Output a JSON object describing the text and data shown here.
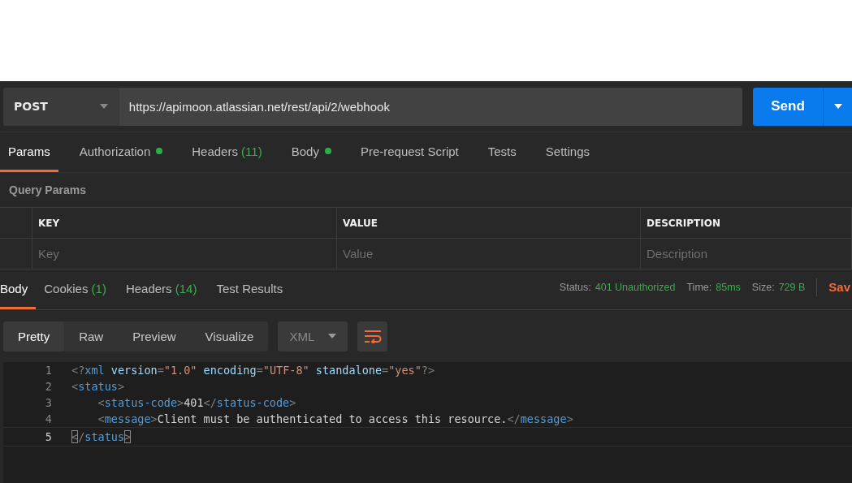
{
  "request": {
    "method": "POST",
    "url": "https://apimoon.atlassian.net/rest/api/2/webhook",
    "send_label": "Send"
  },
  "request_tabs": [
    {
      "label": "Params",
      "indicator": false,
      "selected": true
    },
    {
      "label": "Authorization",
      "indicator": true,
      "selected": false
    },
    {
      "label": "Headers",
      "count": "(11)",
      "indicator": false,
      "selected": false
    },
    {
      "label": "Body",
      "indicator": true,
      "selected": false
    },
    {
      "label": "Pre-request Script",
      "indicator": false,
      "selected": false
    },
    {
      "label": "Tests",
      "indicator": false,
      "selected": false
    },
    {
      "label": "Settings",
      "indicator": false,
      "selected": false
    }
  ],
  "query_params": {
    "title": "Query Params",
    "columns": [
      "KEY",
      "VALUE",
      "DESCRIPTION"
    ],
    "placeholders": [
      "Key",
      "Value",
      "Description"
    ]
  },
  "response_tabs": [
    {
      "label": "Body",
      "selected": true
    },
    {
      "label": "Cookies",
      "count": "(1)",
      "selected": false
    },
    {
      "label": "Headers",
      "count": "(14)",
      "selected": false
    },
    {
      "label": "Test Results",
      "selected": false
    }
  ],
  "response_meta": [
    {
      "label": "Status:",
      "value": "401 Unauthorized"
    },
    {
      "label": "Time:",
      "value": "85ms"
    },
    {
      "label": "Size:",
      "value": "729 B"
    }
  ],
  "save_label": "Sav",
  "view_modes": [
    {
      "label": "Pretty",
      "selected": true
    },
    {
      "label": "Raw",
      "selected": false
    },
    {
      "label": "Preview",
      "selected": false
    },
    {
      "label": "Visualize",
      "selected": false
    }
  ],
  "format": "XML",
  "code_lines": [
    {
      "number": "1",
      "active": false,
      "tokens": [
        {
          "kind": "punct",
          "text": "<?"
        },
        {
          "kind": "tag",
          "text": "xml"
        },
        {
          "kind": "attr",
          "text": " version"
        },
        {
          "kind": "punct",
          "text": "="
        },
        {
          "kind": "string",
          "text": "\"1.0\""
        },
        {
          "kind": "attr",
          "text": " encoding"
        },
        {
          "kind": "punct",
          "text": "="
        },
        {
          "kind": "string",
          "text": "\"UTF-8\""
        },
        {
          "kind": "attr",
          "text": " standalone"
        },
        {
          "kind": "punct",
          "text": "="
        },
        {
          "kind": "string",
          "text": "\"yes\""
        },
        {
          "kind": "punct",
          "text": "?>"
        }
      ]
    },
    {
      "number": "2",
      "active": false,
      "tokens": [
        {
          "kind": "punct",
          "text": "<"
        },
        {
          "kind": "tag",
          "text": "status"
        },
        {
          "kind": "punct",
          "text": ">"
        }
      ]
    },
    {
      "number": "3",
      "active": false,
      "tokens": [
        {
          "kind": "punct",
          "text": "    <"
        },
        {
          "kind": "tag",
          "text": "status-code"
        },
        {
          "kind": "punct",
          "text": ">"
        },
        {
          "kind": "text",
          "text": "401"
        },
        {
          "kind": "punct",
          "text": "</"
        },
        {
          "kind": "tag",
          "text": "status-code"
        },
        {
          "kind": "punct",
          "text": ">"
        }
      ]
    },
    {
      "number": "4",
      "active": false,
      "tokens": [
        {
          "kind": "punct",
          "text": "    <"
        },
        {
          "kind": "tag",
          "text": "message"
        },
        {
          "kind": "punct",
          "text": ">"
        },
        {
          "kind": "text",
          "text": "Client must be authenticated to access this resource."
        },
        {
          "kind": "punct",
          "text": "</"
        },
        {
          "kind": "tag",
          "text": "message"
        },
        {
          "kind": "punct",
          "text": ">"
        }
      ]
    },
    {
      "number": "5",
      "active": true,
      "tokens": [
        {
          "kind": "match",
          "text": "<"
        },
        {
          "kind": "punct",
          "text": "/"
        },
        {
          "kind": "tag",
          "text": "status"
        },
        {
          "kind": "match",
          "text": ">"
        }
      ]
    }
  ]
}
